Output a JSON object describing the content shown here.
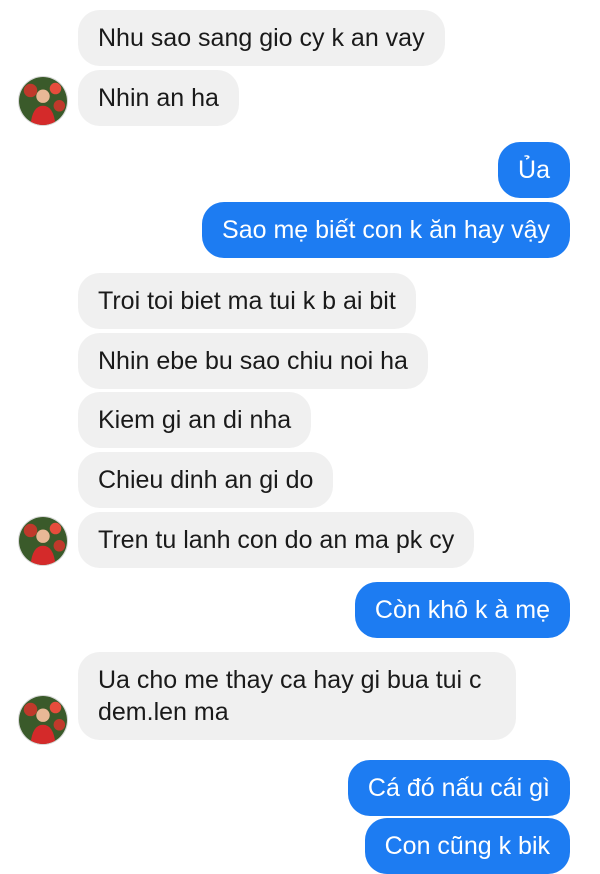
{
  "conversation": {
    "messages": [
      {
        "from": "mom",
        "text": "Nhu sao sang gio cy k an vay"
      },
      {
        "from": "mom",
        "text": "Nhin an ha"
      },
      {
        "from": "me",
        "text": "Ủa"
      },
      {
        "from": "me",
        "text": "Sao mẹ biết con k ăn hay vậy"
      },
      {
        "from": "mom",
        "text": "Troi toi biet ma tui k b ai bit"
      },
      {
        "from": "mom",
        "text": "Nhin ebe bu sao chiu noi ha"
      },
      {
        "from": "mom",
        "text": "Kiem gi an di nha"
      },
      {
        "from": "mom",
        "text": "Chieu dinh an gi do"
      },
      {
        "from": "mom",
        "text": "Tren tu lanh con do an ma pk cy"
      },
      {
        "from": "me",
        "text": "Còn khô k à mẹ"
      },
      {
        "from": "mom",
        "text": "Ua cho me thay ca hay gi bua tui c dem.len ma"
      },
      {
        "from": "me",
        "text": "Cá đó nấu cái gì"
      },
      {
        "from": "me",
        "text": "Con cũng k bik"
      }
    ]
  },
  "colors": {
    "incoming_bubble": "#f0f0f0",
    "outgoing_bubble": "#1d7cf2",
    "incoming_text": "#1a1a1a",
    "outgoing_text": "#ffffff"
  },
  "icons": {
    "avatar": "contact-avatar-photo"
  }
}
